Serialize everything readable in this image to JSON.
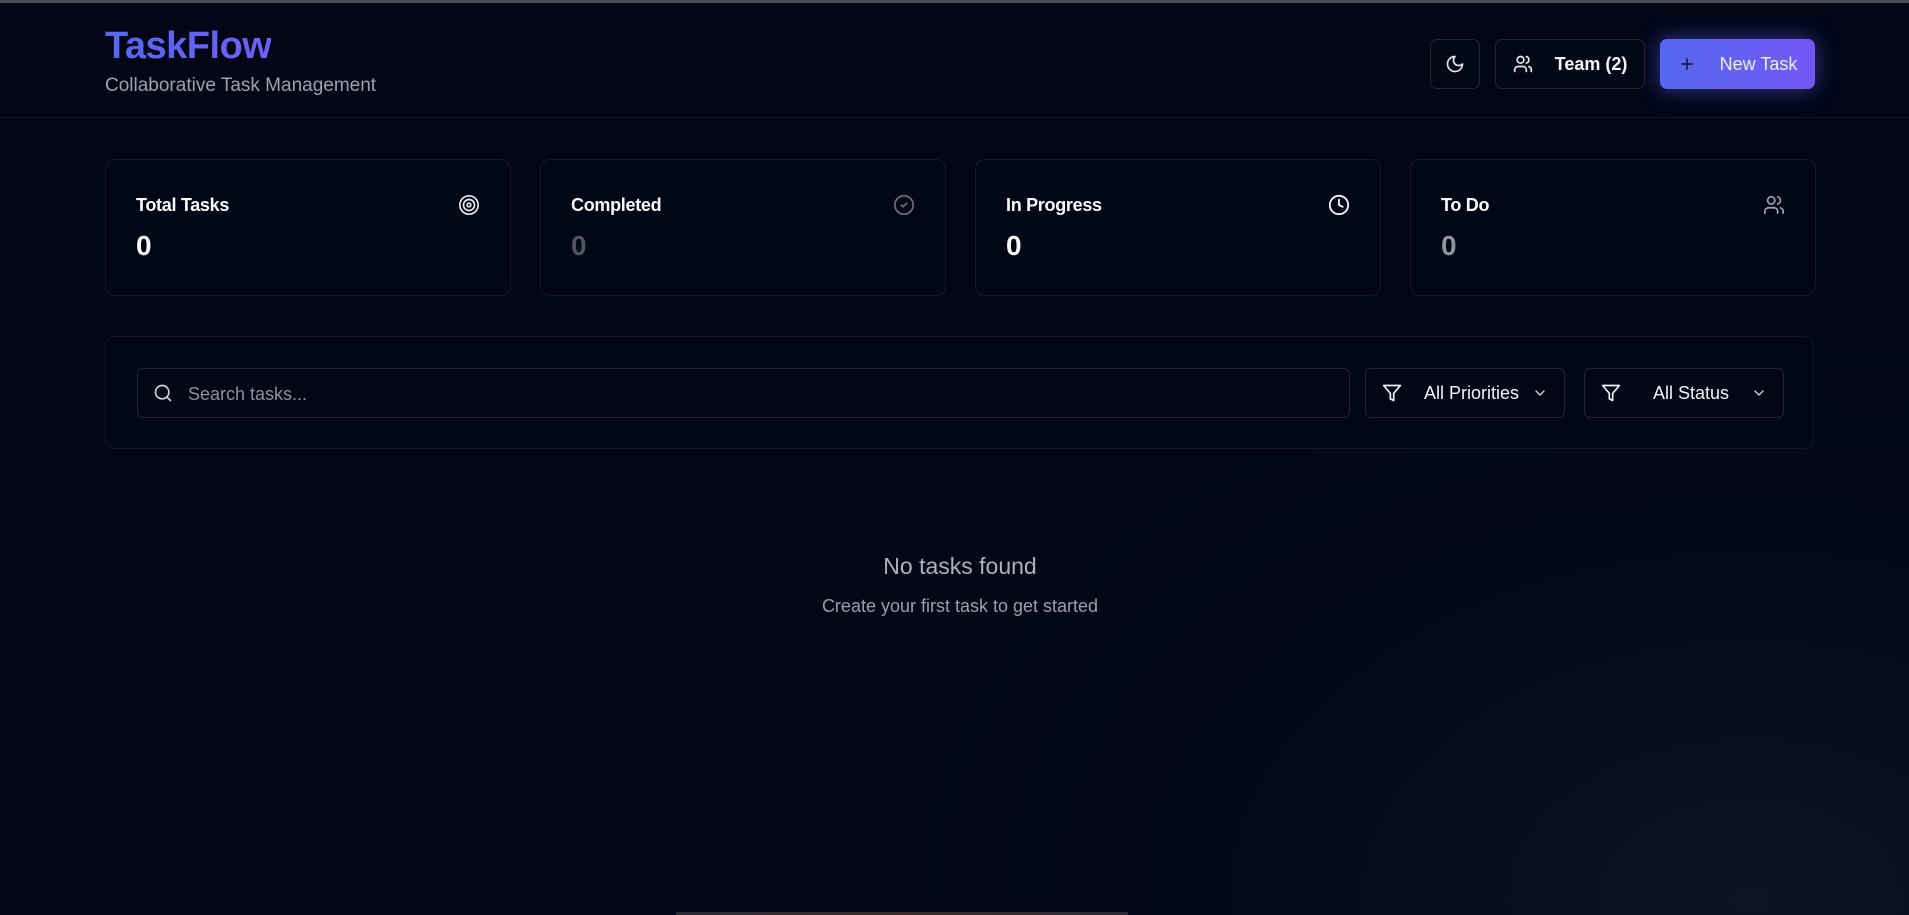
{
  "header": {
    "title": "TaskFlow",
    "subtitle": "Collaborative Task Management",
    "theme_icon": "moon-icon",
    "team_label": "Team (2)",
    "new_task_label": "New Task"
  },
  "stats": [
    {
      "label": "Total Tasks",
      "value": "0",
      "icon": "target-icon",
      "value_color": "#f8fafc"
    },
    {
      "label": "Completed",
      "value": "0",
      "icon": "check-circle-icon",
      "value_color": "#4b5563"
    },
    {
      "label": "In Progress",
      "value": "0",
      "icon": "clock-icon",
      "value_color": "#f8fafc"
    },
    {
      "label": "To Do",
      "value": "0",
      "icon": "users-icon",
      "value_color": "#8b95a7"
    }
  ],
  "filters": {
    "search_placeholder": "Search tasks...",
    "priority_selected": "All Priorities",
    "status_selected": "All Status"
  },
  "empty_state": {
    "title": "No tasks found",
    "subtitle": "Create your first task to get started"
  },
  "colors": {
    "accent": "#5b6ef5",
    "accent_end": "#7557f5",
    "background": "#020617"
  }
}
